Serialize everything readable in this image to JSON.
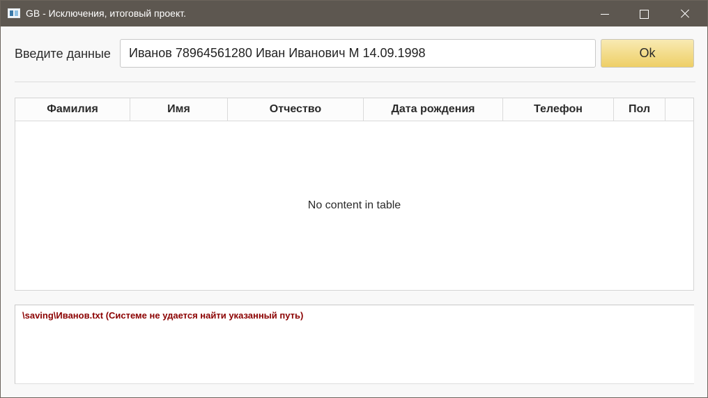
{
  "window": {
    "title": "GB - Исключения, итоговый проект.",
    "icons": {
      "app": "app-window-icon",
      "minimize": "minimize-icon",
      "maximize": "maximize-icon",
      "close": "close-icon"
    }
  },
  "form": {
    "label": "Введите данные",
    "input_value": "Иванов 78964561280 Иван Иванович М 14.09.1998",
    "ok_label": "Ok"
  },
  "table": {
    "columns": [
      "Фамилия",
      "Имя",
      "Отчество",
      "Дата рождения",
      "Телефон",
      "Пол",
      ""
    ],
    "placeholder": "No content in table"
  },
  "log": {
    "message": "\\saving\\Иванов.txt (Системе не удается найти указанный путь)",
    "color": "#8b0000"
  },
  "colors": {
    "titlebar": "#5d5750",
    "button_accent": "#eecf66"
  }
}
